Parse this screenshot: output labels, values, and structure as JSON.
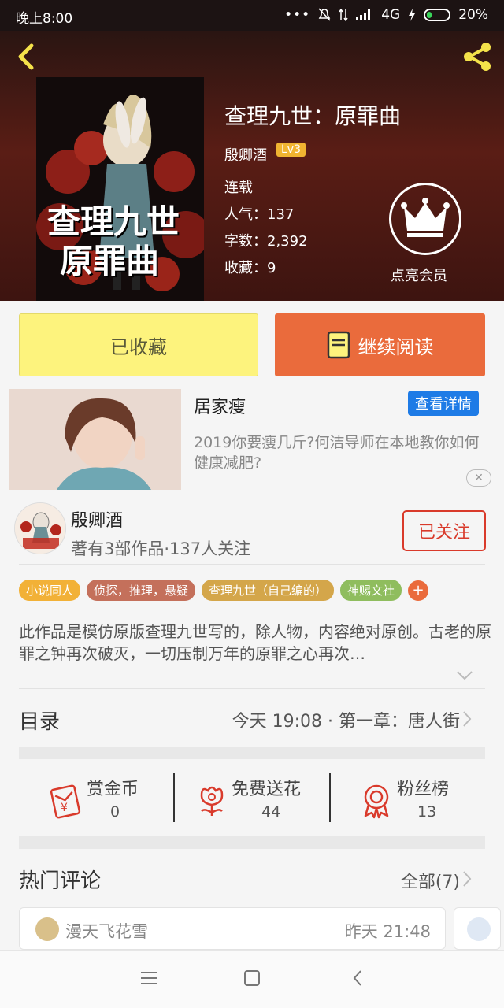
{
  "status": {
    "time": "晚上8:00",
    "network": "4G",
    "battery": "20%",
    "battery_level": 0.2
  },
  "book": {
    "title": "查理九世：原罪曲",
    "author": "殷卿酒",
    "level": "Lv3",
    "status": "连载",
    "popularity": "人气：137",
    "words": "字数：2,392",
    "favorites": "收藏：9",
    "cover_text_line1": "查理九世",
    "cover_text_line2": "原罪曲"
  },
  "vip": {
    "label": "点亮会员"
  },
  "actions": {
    "favorited": "已收藏",
    "continue_reading": "继续阅读"
  },
  "ad": {
    "title": "居家瘦",
    "details_button": "查看详情",
    "description": "2019你要瘦几斤?何洁导师在本地教你如何健康减肥?",
    "close": "✕"
  },
  "author_info": {
    "name": "殷卿酒",
    "stats": "著有3部作品·137人关注",
    "follow_button": "已关注"
  },
  "tags": [
    {
      "label": "小说同人",
      "color": "#f2b137"
    },
    {
      "label": "侦探，推理，悬疑",
      "color": "#c4705b"
    },
    {
      "label": "查理九世（自己编的）",
      "color": "#d4a64a"
    },
    {
      "label": "神赐文社",
      "color": "#8fbd5e"
    }
  ],
  "tag_add": "+",
  "description": "此作品是模仿原版查理九世写的，除人物，内容绝对原创。古老的原罪之钟再次破灭，一切压制万年的原罪之心再次…",
  "toc": {
    "label": "目录",
    "latest": "今天 19:08 · 第一章：唐人街"
  },
  "stats": [
    {
      "label": "赏金币",
      "value": "0",
      "icon": "red-envelope-icon"
    },
    {
      "label": "免费送花",
      "value": "44",
      "icon": "flower-icon"
    },
    {
      "label": "粉丝榜",
      "value": "13",
      "icon": "medal-icon"
    }
  ],
  "comments": {
    "label": "热门评论",
    "all": "全部(7)",
    "items": [
      {
        "user": "漫天飞花雪",
        "time": "昨天 21:48"
      }
    ]
  },
  "colors": {
    "accent": "#ea6b3c",
    "favorite_bg": "#fdf37d",
    "follow_red": "#d93a2b",
    "ad_blue": "#1e7be6"
  }
}
